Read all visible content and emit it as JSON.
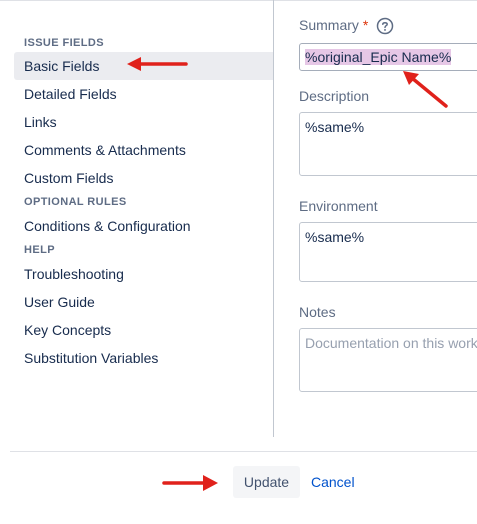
{
  "sidebar": {
    "headings": {
      "issue_fields": "ISSUE FIELDS",
      "optional_rules": "OPTIONAL RULES",
      "help": "HELP"
    },
    "items": [
      {
        "label": "Basic Fields",
        "active": true
      },
      {
        "label": "Detailed Fields"
      },
      {
        "label": "Links"
      },
      {
        "label": "Comments & Attachments"
      },
      {
        "label": "Custom Fields"
      },
      {
        "label": "Conditions & Configuration"
      },
      {
        "label": "Troubleshooting"
      },
      {
        "label": "User Guide"
      },
      {
        "label": "Key Concepts"
      },
      {
        "label": "Substitution Variables"
      }
    ]
  },
  "form": {
    "summary": {
      "label": "Summary",
      "required_mark": "*",
      "value": "%original_Epic Name%"
    },
    "description": {
      "label": "Description",
      "value": "%same%"
    },
    "environment": {
      "label": "Environment",
      "value": "%same%"
    },
    "notes": {
      "label": "Notes",
      "placeholder": "Documentation on this workf"
    }
  },
  "footer": {
    "update_label": "Update",
    "cancel_label": "Cancel"
  },
  "colors": {
    "annotation_arrow": "#e0211b",
    "highlight": "#e6c7e6",
    "link": "#0052cc"
  }
}
